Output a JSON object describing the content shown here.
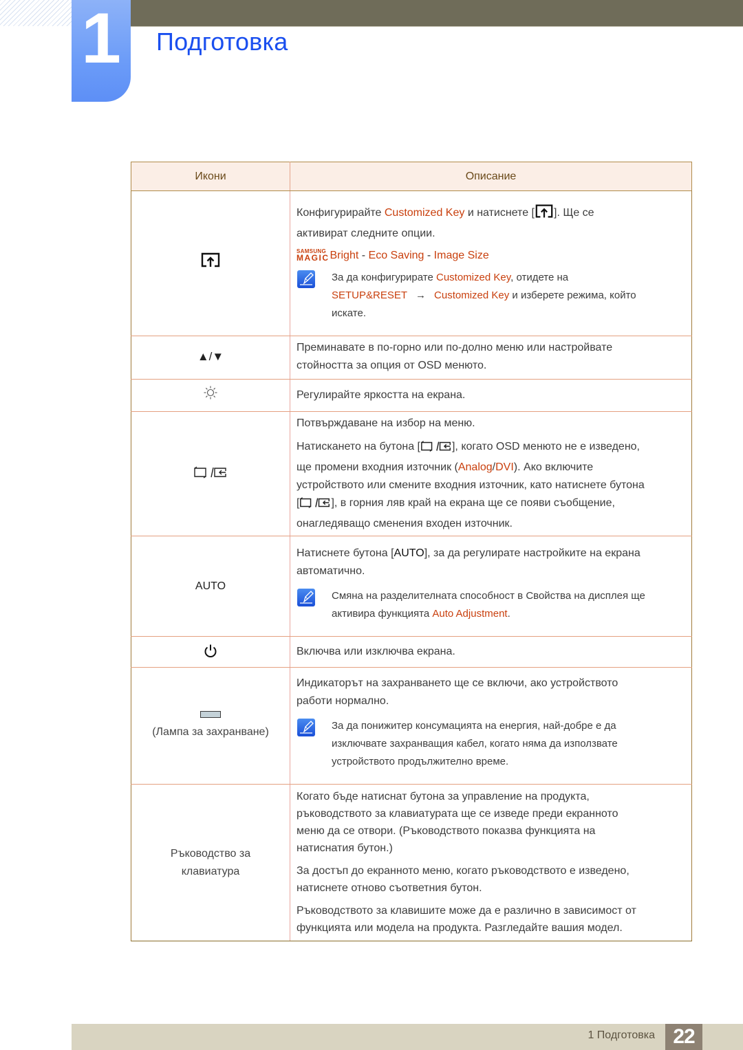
{
  "header": {
    "chapter_number": "1",
    "chapter_title": "Подготовка"
  },
  "table": {
    "col_icons": "Икони",
    "col_description": "Описание",
    "rows": {
      "custom_key": {
        "icon": "customized-key-icon",
        "p1_a": "Конфигурирайте ",
        "p1_hl": "Customized Key",
        "p1_b": " и натиснете [",
        "p1_c": "]. Ще се",
        "p1_d": "активират следните опции.",
        "magic_logo_top": "SAMSUNG",
        "magic_logo_bottom": "MAGIC",
        "opt1": "Bright",
        "sep": " - ",
        "opt2": "Eco Saving",
        "opt3": "Image Size",
        "note_a": "За да конфигурирате ",
        "note_hl1": "Customized Key",
        "note_b": ", отидете на",
        "note_hl2": "SETUP&RESET",
        "note_arrow": "→",
        "note_hl3": "Customized Key",
        "note_c": " и изберете режима, който",
        "note_d": "искате."
      },
      "updown": {
        "icon": "up-down-arrows-icon",
        "icon_text": "▲/▼",
        "p1": "Преминавате в по-горно или по-долно меню или настройвате",
        "p2": "стойността за опция от OSD менюто."
      },
      "brightness": {
        "icon": "brightness-sun-icon",
        "p1": "Регулирайте яркостта на екрана."
      },
      "source": {
        "icon": "source-enter-icon",
        "p1": "Потвърждаване на избор на меню.",
        "p2_a": "Натискането на бутона [",
        "p2_b": "], когато OSD менюто не е изведено,",
        "p2_c": "ще промени входния източник (",
        "p2_hl1": "Analog",
        "p2_slash": "/",
        "p2_hl2": "DVI",
        "p2_d": "). Ако включите",
        "p2_e": "устройството или смените входния източник, като натиснете бутона",
        "p2_f": "], в горния ляв край на екрана ще се появи съобщение,",
        "p2_g": "онагледяващо сменения входен източник."
      },
      "auto": {
        "icon_text": "AUTO",
        "p1_a": "Натиснете бутона [",
        "p1_key": "AUTO",
        "p1_b": "], за да регулирате настройките на екрана",
        "p1_c": "автоматично.",
        "note_a": "Смяна на разделителната способност в Свойства на дисплея ще",
        "note_b": "активира функцията ",
        "note_hl": "Auto Adjustment",
        "note_c": "."
      },
      "power": {
        "icon": "power-icon",
        "p1": "Включва или изключва екрана."
      },
      "power_lamp": {
        "icon": "power-lamp-icon",
        "label": "(Лампа за захранване)",
        "p1": "Индикаторът на захранването ще се включи, ако устройството",
        "p2": "работи нормално.",
        "note_a": "За да понижитер консумацията на енергия, най-добре е да",
        "note_b": "изключвате захранващия кабел, когато няма да използвате",
        "note_c": "устройството продължително време."
      },
      "key_guide": {
        "label_a": "Ръководство за",
        "label_b": "клавиатура",
        "p1_a": "Когато бъде натиснат бутона за управление на продукта,",
        "p1_b": "ръководството за клавиатурата ще се изведе преди екранното",
        "p1_c": "меню да се отвори. (Ръководството показва функцията на",
        "p1_d": "натиснатия бутон.)",
        "p2_a": "За достъп до екранното меню, когато ръководството е изведено,",
        "p2_b": "натиснете отново съответния бутон.",
        "p3_a": "Ръководството за клавишите може да е различно в зависимост от",
        "p3_b": "функцията или модела на продукта. Разгледайте вашия модел."
      }
    }
  },
  "footer": {
    "section": "1 Подготовка",
    "page": "22"
  },
  "colors": {
    "title_blue": "#1a4fef",
    "highlight": "#c9400e",
    "header_bar": "#6f6c59",
    "footer_bar": "#d9d4c1",
    "page_box": "#8e8273"
  }
}
